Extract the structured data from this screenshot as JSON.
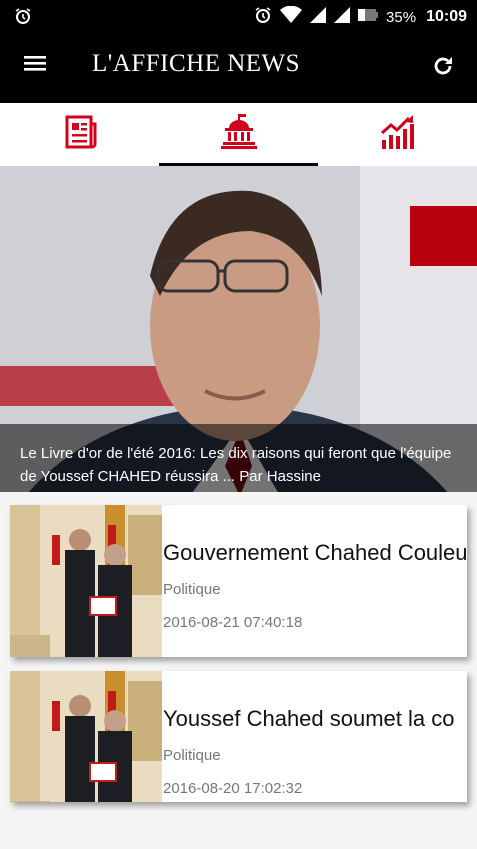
{
  "status_bar": {
    "battery": "35%",
    "time": "10:09",
    "icons": [
      "alarm-icon",
      "wifi-icon",
      "signal-icon",
      "battery-icon"
    ]
  },
  "app_bar": {
    "title": "L'AFFICHE NEWS",
    "menu_icon": "hamburger-menu-icon",
    "refresh_icon": "refresh-icon"
  },
  "tabs": [
    {
      "icon": "newspaper-icon",
      "active": false
    },
    {
      "icon": "government-building-icon",
      "active": true
    },
    {
      "icon": "trending-chart-icon",
      "active": false
    }
  ],
  "colors": {
    "accent": "#d0021b",
    "bar": "#000000"
  },
  "hero": {
    "caption": "Le Livre d'or de l'été 2016: Les dix raisons qui feront que l'équipe de Youssef CHAHED réussira ... Par Hassine"
  },
  "articles": [
    {
      "title": "Gouvernement Chahed Couleu",
      "category": "Politique",
      "date": "2016-08-21 07:40:18"
    },
    {
      "title": "Youssef Chahed soumet la co",
      "category": "Politique",
      "date": "2016-08-20 17:02:32"
    }
  ]
}
